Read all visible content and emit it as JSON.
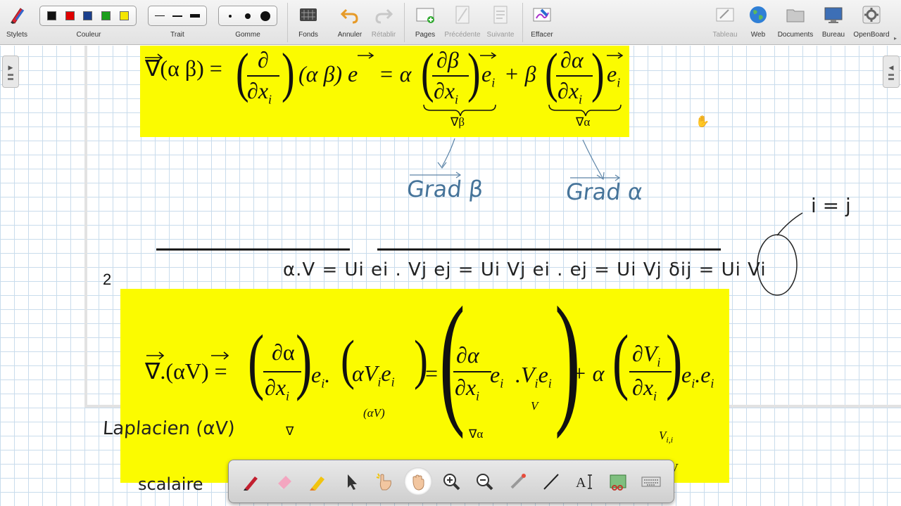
{
  "toolbar": {
    "stylets": "Stylets",
    "couleur": "Couleur",
    "trait": "Trait",
    "gomme": "Gomme",
    "fonds": "Fonds",
    "annuler": "Annuler",
    "retablir": "Rétablir",
    "pages": "Pages",
    "precedente": "Précédente",
    "suivante": "Suivante",
    "effacer": "Effacer",
    "tableau": "Tableau",
    "web": "Web",
    "documents": "Documents",
    "bureau": "Bureau",
    "openboard": "OpenBoard",
    "colors": [
      "#111111",
      "#e00000",
      "#1b3f8c",
      "#1a9e1a",
      "#f5e600"
    ]
  },
  "board": {
    "page_number": "2",
    "eq1": {
      "lhs": "∇(α β) =",
      "mid": "(α β) e",
      "eq_alpha": "= α",
      "plus_beta": "+ β",
      "d": "∂",
      "dbeta": "∂β",
      "dalpha": "∂α",
      "dx": "∂x",
      "sub_i": "i",
      "e": "e",
      "ubrace1": "∇β",
      "ubrace2": "∇α"
    },
    "handwriting": {
      "grad_beta": "Grad β",
      "grad_alpha": "Grad α",
      "i_eq_j": "i = j",
      "dot_product": "α.V = Ui ei . Vj ej = Ui Vj ei . ej = Ui Vj δij = Ui Vi",
      "laplacien": "Laplacien (αV)",
      "scalaire": "scalaire"
    },
    "eq2": {
      "lhs": "∇.(αV) =",
      "dot": ".",
      "alpha_v_e": "αV",
      "eq": "=",
      "plus_alpha": "+ α",
      "dalpha": "∂α",
      "dVi": "∂V",
      "dx": "∂x",
      "ei": "e",
      "sub_i": "i",
      "ubrace_nabla": "∇",
      "ubrace_alphaV": "(αV)",
      "ubrace_grad_alpha": "∇α",
      "ubrace_V": "V",
      "ubrace_Vii": "V",
      "sub_ii": "i,i",
      "nabla_v": "∇.V"
    }
  }
}
